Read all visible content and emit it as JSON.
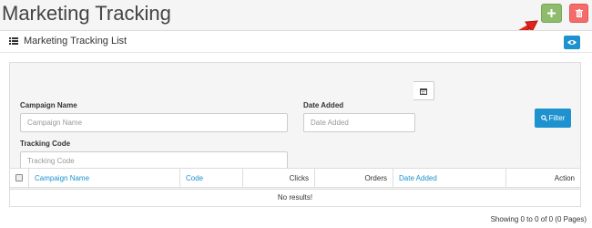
{
  "header": {
    "title": "Marketing Tracking",
    "add_icon": "plus-icon",
    "delete_icon": "trash-icon"
  },
  "panel": {
    "title": "Marketing Tracking List",
    "toggle_icon": "eye-icon",
    "list_icon": "list-icon"
  },
  "filter": {
    "campaign_label": "Campaign Name",
    "campaign_placeholder": "Campaign Name",
    "date_label": "Date Added",
    "date_placeholder": "Date Added",
    "code_label": "Tracking Code",
    "code_placeholder": "Tracking Code",
    "button_label": "Filter",
    "calendar_icon": "calendar-icon",
    "search_icon": "search-icon"
  },
  "table": {
    "columns": [
      "Campaign Name",
      "Code",
      "Clicks",
      "Orders",
      "Date Added",
      "Action"
    ],
    "empty_text": "No results!"
  },
  "pagination": {
    "text": "Showing 0 to 0 of 0 (0 Pages)"
  },
  "colors": {
    "add": "#8fbb6c",
    "delete": "#f56b6b",
    "primary": "#1e91cf",
    "arrow": "#e2231a"
  }
}
